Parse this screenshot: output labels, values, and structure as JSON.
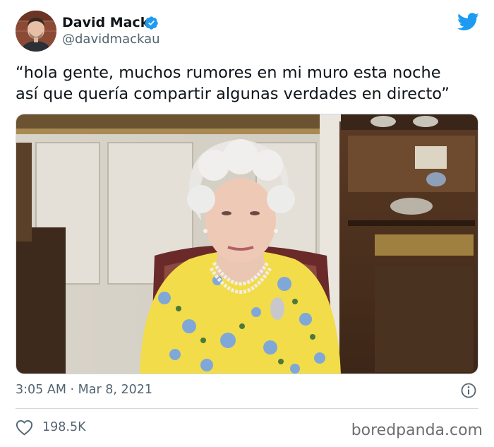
{
  "author": {
    "name": "David Mack",
    "handle": "@davidmackau",
    "verified": true,
    "avatar_icon": "profile-photo"
  },
  "tweet": {
    "text": "“hola gente, muchos rumores en mi muro esta noche\nasí que quería compartir algunas verdades en directo”",
    "media_description_icon": "photo-elderly-woman-yellow-floral-dress",
    "timestamp": "3:05 AM · Mar 8, 2021"
  },
  "engagement": {
    "likes": "198.5K",
    "like_icon": "heart-outline-icon",
    "info_icon": "info-circle-icon"
  },
  "brand": {
    "twitter_icon": "twitter-bird-icon",
    "twitter_color": "#1d9bf0",
    "verified_color": "#1d9bf0",
    "watermark": "boredpanda.com"
  }
}
